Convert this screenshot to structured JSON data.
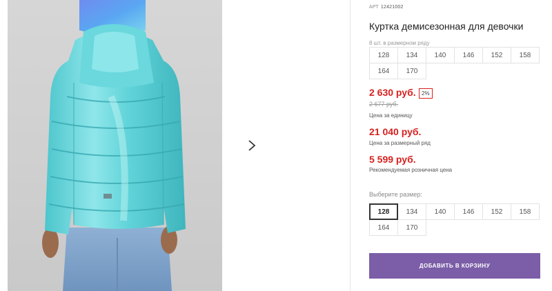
{
  "product": {
    "sku_label": "АРТ",
    "sku_number": "12421002",
    "title": "Куртка демисезонная для девочки",
    "row_note": "8 шт. в размерном ряду",
    "row_sizes": [
      "128",
      "134",
      "140",
      "146",
      "152",
      "158",
      "164",
      "170"
    ]
  },
  "pricing": {
    "unit_price": "2 630 руб.",
    "discount": "2%",
    "old_price": "2 677 руб.",
    "unit_label": "Цена за единицу",
    "set_price": "21 040 руб.",
    "set_label": "Цена за размерный ряд",
    "rrp_price": "5 599 руб.",
    "rrp_label": "Рекомендуемая розничная цена"
  },
  "size_picker": {
    "label": "Выберите размер:",
    "sizes": [
      "128",
      "134",
      "140",
      "146",
      "152",
      "158",
      "164",
      "170"
    ],
    "selected": "128"
  },
  "cart": {
    "button_label": "ДОБАВИТЬ В КОРЗИНУ"
  },
  "gallery": {
    "next_icon": "chevron-right-icon"
  },
  "colors": {
    "price_red": "#d6211f",
    "button_purple": "#7b5ea7",
    "jacket_turquoise": "#5fd3d8"
  }
}
